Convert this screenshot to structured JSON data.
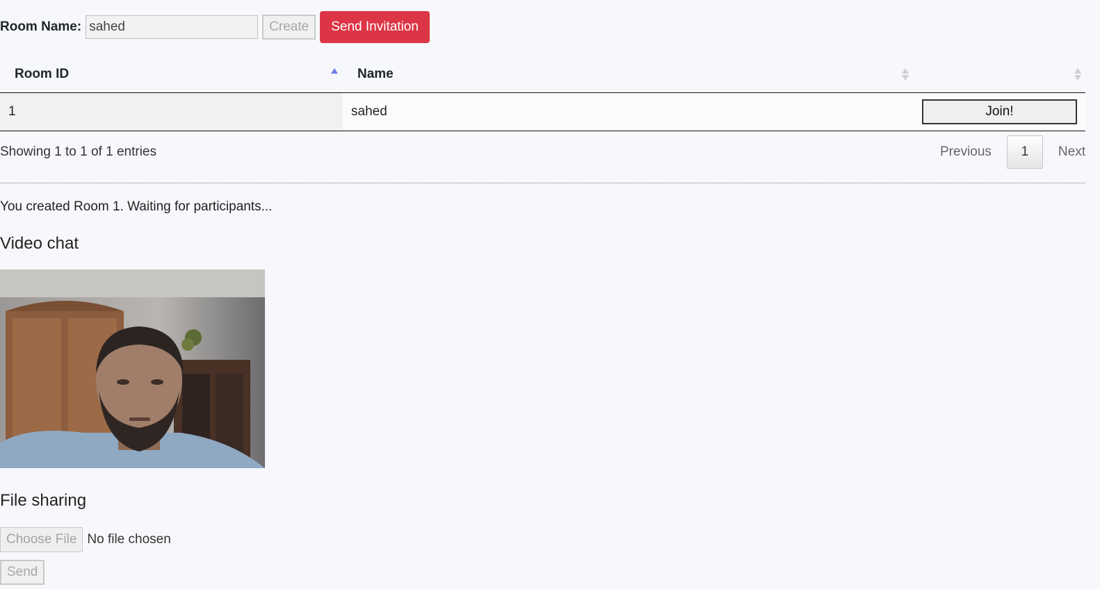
{
  "room_bar": {
    "label": "Room Name:",
    "input_value": "sahed",
    "create_label": "Create",
    "invite_label": "Send Invitation"
  },
  "table": {
    "headers": [
      "Room ID",
      "Name",
      ""
    ],
    "rows": [
      {
        "id": "1",
        "name": "sahed",
        "action_label": "Join!"
      }
    ],
    "info": "Showing 1 to 1 of 1 entries",
    "pagination": {
      "previous": "Previous",
      "current": "1",
      "next": "Next"
    }
  },
  "status_message": "You created Room 1. Waiting for participants...",
  "video": {
    "heading": "Video chat"
  },
  "file_sharing": {
    "heading": "File sharing",
    "choose_label": "Choose File",
    "file_status": "No file chosen",
    "send_label": "Send"
  },
  "colors": {
    "invite_button": "#dc3545",
    "sort_active": "#6f7ee8",
    "sort_inactive": "#cfcfcf"
  },
  "icons": {
    "sort_asc": "sort-ascending-icon",
    "sort_both": "sort-both-icon"
  }
}
